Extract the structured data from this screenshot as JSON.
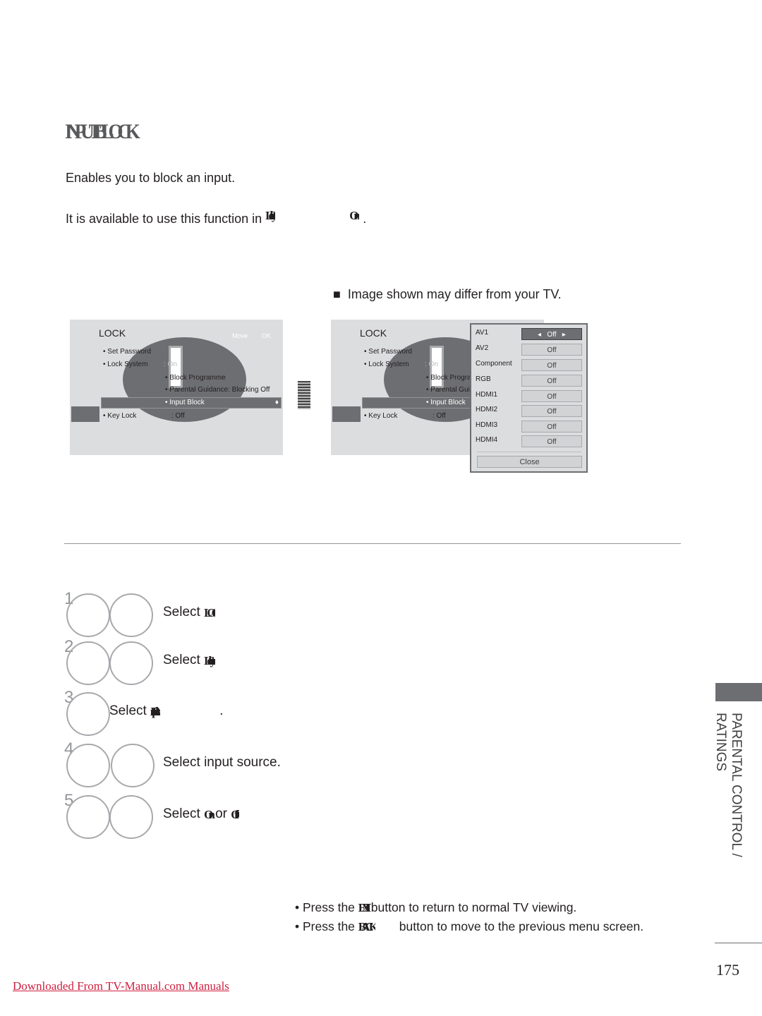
{
  "title": "INPUT BLOCK",
  "intro": "Enables you to block an input.",
  "availability": {
    "prefix": "It is available to use this function in",
    "mode": "Lock System",
    "mode2": "On",
    "suffix": "."
  },
  "note": "Image shown may differ from your TV.",
  "screen1": {
    "heading": "LOCK",
    "move": "Move",
    "ok": "OK",
    "items": [
      "Set Password",
      "Lock System",
      ": On",
      "Block Programme",
      "Parental Guidance: Blocking Off",
      "Input Block",
      "Key Lock",
      ": Off"
    ]
  },
  "screen2": {
    "heading": "LOCK",
    "items": [
      "Set Password",
      "Lock System",
      ": On",
      "Block Progra",
      "Parental Gui",
      "Input Block",
      "Key Lock",
      ": Off"
    ]
  },
  "popup": {
    "rows": [
      {
        "label": "AV1",
        "value": "Off"
      },
      {
        "label": "AV2",
        "value": "Off"
      },
      {
        "label": "Component",
        "value": "Off"
      },
      {
        "label": "RGB",
        "value": "Off"
      },
      {
        "label": "HDMI1",
        "value": "Off"
      },
      {
        "label": "HDMI2",
        "value": "Off"
      },
      {
        "label": "HDMI3",
        "value": "Off"
      },
      {
        "label": "HDMI4",
        "value": "Off"
      }
    ],
    "close": "Close"
  },
  "steps": [
    {
      "num": "1",
      "prefix": "Select",
      "key": "LOCK",
      "suffix": ""
    },
    {
      "num": "2",
      "prefix": "Select",
      "key": "Lock System",
      "suffix": ""
    },
    {
      "num": "3",
      "prefix": "Select",
      "key": "Input Block",
      "suffix": "."
    },
    {
      "num": "4",
      "prefix": "Select input source.",
      "key": "",
      "suffix": ""
    },
    {
      "num": "5",
      "prefix": "Select",
      "key": "On",
      "mid": "or",
      "key2": "Off",
      "suffix": ""
    }
  ],
  "tips": [
    {
      "prefix": "• Press the",
      "key": "EXIT",
      "suffix": "button to return to normal TV viewing."
    },
    {
      "prefix": "• Press the",
      "key": "BACK",
      "suffix": "button to move to the previous menu screen."
    }
  ],
  "sidebar": {
    "section": "PARENTAL CONTROL / RATINGS"
  },
  "page_number": "175",
  "footer_link": "Downloaded From TV-Manual.com Manuals"
}
